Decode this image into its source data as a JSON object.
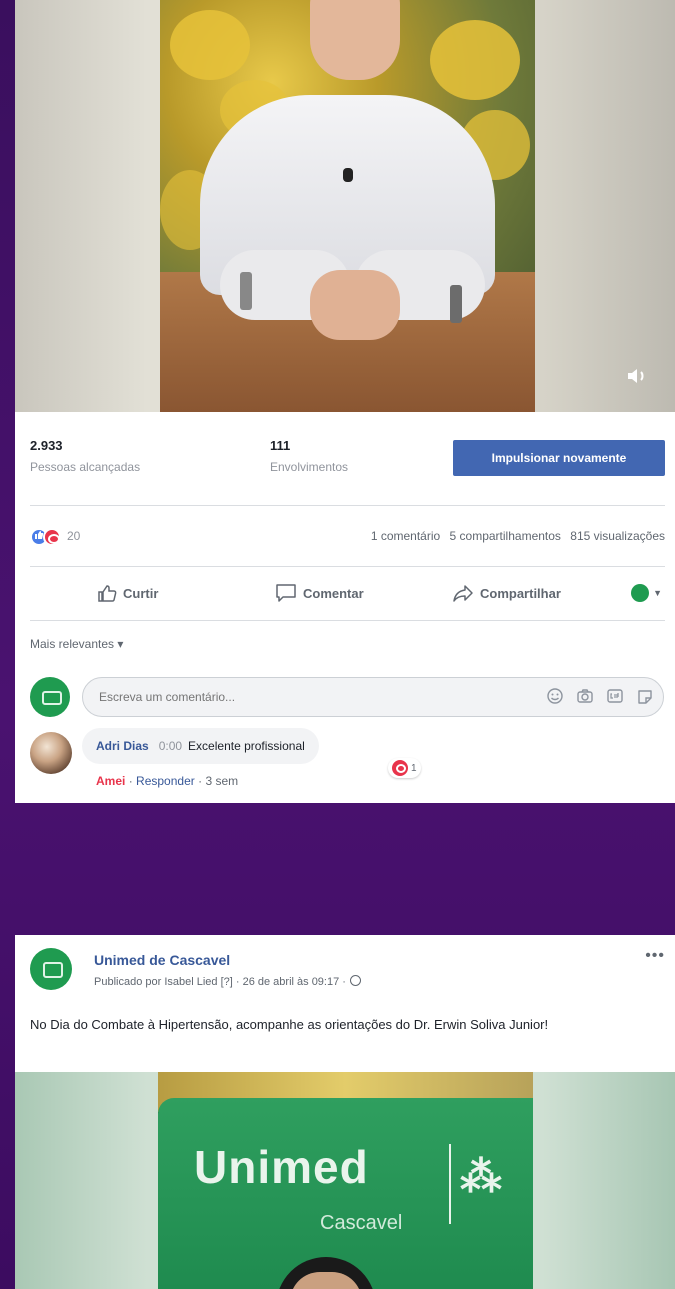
{
  "post1": {
    "stats": {
      "reach_value": "2.933",
      "reach_label": "Pessoas alcançadas",
      "engagement_value": "111",
      "engagement_label": "Envolvimentos",
      "boost_label": "Impulsionar novamente"
    },
    "reactions": {
      "count": "20",
      "comments": "1 comentário",
      "shares": "5 compartilhamentos",
      "views": "815 visualizações"
    },
    "actions": {
      "like": "Curtir",
      "comment": "Comentar",
      "share": "Compartilhar"
    },
    "sort_label": "Mais relevantes ▾",
    "comment_input": {
      "placeholder": "Escreva um comentário..."
    },
    "reply": {
      "author": "Adri Dias",
      "timestamp": "0:00",
      "text": "Excelente profissional",
      "reaction_count": "1",
      "reacted": "Amei",
      "reply_link": "Responder",
      "age": "3 sem"
    }
  },
  "post2": {
    "page_name": "Unimed de Cascavel",
    "meta": "Publicado por Isabel Lied [?] · 26 de abril às 09:17 ·",
    "text": "No Dia do Combate à Hipertensão, acompanhe as orientações do Dr. Erwin Soliva Junior!",
    "more": "•••",
    "video_logo": "Unimed",
    "video_city": "Cascavel"
  },
  "colors": {
    "brand_blue": "#4267b2",
    "link_blue": "#385898",
    "unimed_green": "#1f9b50",
    "love_red": "#e8344b",
    "background_purple": "#3a0f5e"
  },
  "icons": [
    "volume-icon",
    "like-reaction-icon",
    "love-reaction-icon",
    "thumbs-up-icon",
    "comment-icon",
    "share-icon",
    "emoji-icon",
    "camera-icon",
    "gif-icon",
    "sticker-icon",
    "globe-icon",
    "more-icon"
  ]
}
